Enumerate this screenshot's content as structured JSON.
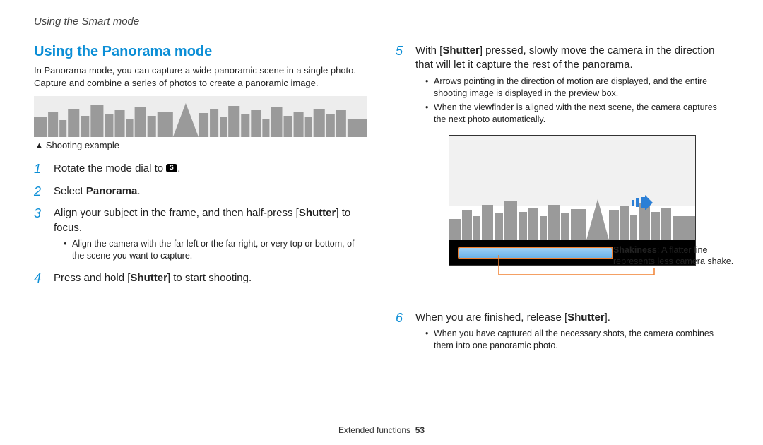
{
  "header": "Using the Smart mode",
  "title": "Using the Panorama mode",
  "intro": "In Panorama mode, you can capture a wide panoramic scene in a single photo. Capture and combine a series of photos to create a panoramic image.",
  "caption": "Shooting example",
  "steps": {
    "s1_pre": "Rotate the mode dial to ",
    "s1_post": ".",
    "s2_pre": "Select ",
    "s2_bold": "Panorama",
    "s2_post": ".",
    "s3_a": "Align your subject in the frame, and then half-press [",
    "s3_b": "Shutter",
    "s3_c": "] to focus.",
    "s3_sub": "Align the camera with the far left or the far right, or very top or bottom, of the scene you want to capture.",
    "s4_a": "Press and hold [",
    "s4_b": "Shutter",
    "s4_c": "] to start shooting.",
    "s5_a": "With [",
    "s5_b": "Shutter",
    "s5_c": "] pressed, slowly move the camera in the direction that will let it capture the rest of the panorama.",
    "s5_sub1": "Arrows pointing in the direction of motion are displayed, and the entire shooting image is displayed in the preview box.",
    "s5_sub2": "When the viewfinder is aligned with the next scene, the camera captures the next photo automatically.",
    "s6_a": "When you are finished, release [",
    "s6_b": "Shutter",
    "s6_c": "].",
    "s6_sub": "When you have captured all the necessary shots, the camera combines them into one panoramic photo."
  },
  "callout": {
    "bold": "Shakiness",
    "rest": ": A flatter line represents less camera shake."
  },
  "footer": {
    "section": "Extended functions",
    "page": "53"
  },
  "nums": {
    "n1": "1",
    "n2": "2",
    "n3": "3",
    "n4": "4",
    "n5": "5",
    "n6": "6"
  }
}
